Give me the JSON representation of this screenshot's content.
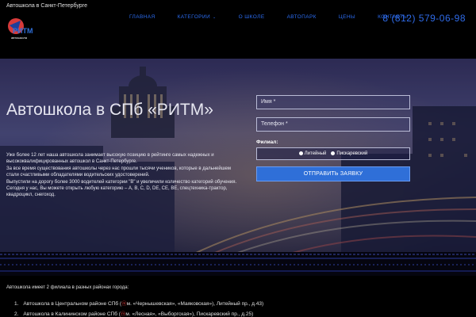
{
  "header": {
    "tagline": "Автошкола в Санкт-Петербурге",
    "logo_text": "РИТМ",
    "logo_subtext": "автошкола",
    "nav": [
      {
        "label": "ГЛАВНАЯ",
        "has_dropdown": false
      },
      {
        "label": "КАТЕГОРИИ",
        "has_dropdown": true
      },
      {
        "label": "О ШКОЛЕ",
        "has_dropdown": false
      },
      {
        "label": "АВТОПАРК",
        "has_dropdown": false
      },
      {
        "label": "ЦЕНЫ",
        "has_dropdown": false
      },
      {
        "label": "КОНТАКТЫ",
        "has_dropdown": false
      }
    ],
    "caret": "⌄",
    "phone": "8 (812) 579-06-98"
  },
  "hero": {
    "title": "Автошкола в СПб «РИТМ»",
    "paragraphs": [
      "Уже более 12 лет наша автошкола занимает высокую позицию в рейтинге самых надежных и высококвалифицированных автошкол в Санкт-Петербурге.",
      "За все время существования автошколы через нас прошли тысячи учеников, которые в дальнейшем стали счастливыми обладателями водительских удостоверений.",
      "Выпустили на дорогу более 3000 водителей категории \"В\" и увеличили количество категорий обучения. Сегодня у нас, Вы можете открыть любую категорию – A, B, C, D, DE, CE, BE, спецтехника-трактор, квадроцикл, снегоход."
    ]
  },
  "form": {
    "name_placeholder": "Имя *",
    "phone_placeholder": "Телефон *",
    "filial_label": "Филиал:",
    "filial_options": [
      "Литейный",
      "Пискаревский"
    ],
    "submit_label": "ОТПРАВИТЬ ЗАЯВКУ"
  },
  "branches": {
    "intro": "Автошкола имеет 2 филиала в разных районах города:",
    "items": [
      {
        "num": "1.",
        "text": "Автошкола в Центральном районе СПб (",
        "metro": "м. «Чернышевская», «Маяковская»",
        "address": "), Литейный пр., д.43)"
      },
      {
        "num": "2.",
        "text": "Автошкола в Калининском районе СПб (",
        "metro": "м. «Лесная», «Выборгская»",
        "address": "), Пискаревский пр., д.25)"
      }
    ]
  },
  "colors": {
    "accent": "#2f6fd8",
    "nav": "#2b6cf0",
    "metro": "#e23a3a"
  }
}
